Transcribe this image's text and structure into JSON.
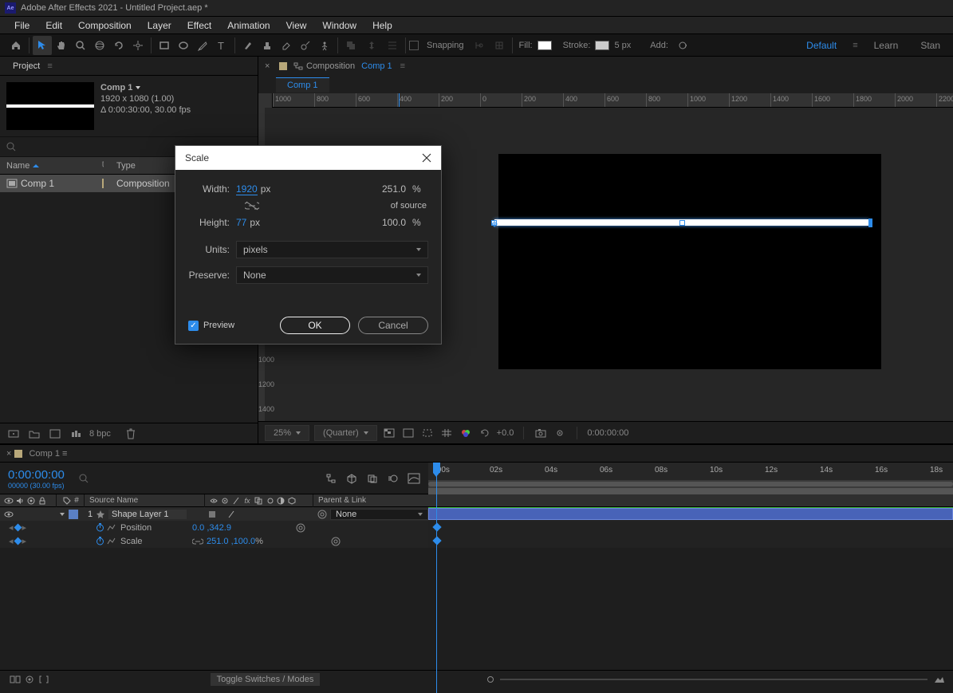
{
  "titlebar": {
    "app": "Adobe After Effects 2021",
    "file": "Untitled Project.aep *",
    "logo": "Ae"
  },
  "menu": [
    "File",
    "Edit",
    "Composition",
    "Layer",
    "Effect",
    "Animation",
    "View",
    "Window",
    "Help"
  ],
  "toolbar": {
    "snapping": "Snapping",
    "fill_label": "Fill:",
    "stroke_label": "Stroke:",
    "stroke_px": "5 px",
    "add_label": "Add:",
    "ws_default": "Default",
    "ws_learn": "Learn",
    "ws_standard": "Stan"
  },
  "project": {
    "tab": "Project",
    "comp_name": "Comp 1",
    "dims": "1920 x 1080 (1.00)",
    "dur": "Δ 0:00:30:00, 30.00 fps",
    "col_name": "Name",
    "col_type": "Type",
    "row_name": "Comp 1",
    "row_type": "Composition",
    "bpc": "8 bpc"
  },
  "comp_panel": {
    "label": "Composition",
    "name": "Comp 1",
    "subtab": "Comp 1",
    "ruler_ticks": [
      "1000",
      "800",
      "600",
      "400",
      "200",
      "0",
      "200",
      "400",
      "600",
      "800",
      "1000",
      "1200",
      "1400",
      "1600",
      "1800",
      "2000",
      "2200"
    ]
  },
  "comp_footer": {
    "zoom": "25%",
    "res": "(Quarter)",
    "exposure": "+0.0",
    "time": "0:00:00:00"
  },
  "dialog": {
    "title": "Scale",
    "width_label": "Width:",
    "width_val": "1920",
    "width_unit": "px",
    "width_pct": "251.0",
    "height_label": "Height:",
    "height_val": "77",
    "height_unit": "px",
    "height_pct": "100.0",
    "pct": "%",
    "of_source": "of source",
    "units_label": "Units:",
    "units_val": "pixels",
    "preserve_label": "Preserve:",
    "preserve_val": "None",
    "preview": "Preview",
    "ok": "OK",
    "cancel": "Cancel"
  },
  "timeline": {
    "tab": "Comp 1",
    "timecode": "0:00:00:00",
    "frames": "00000 (30.00 fps)",
    "ticks": [
      ":00s",
      "02s",
      "04s",
      "06s",
      "08s",
      "10s",
      "12s",
      "14s",
      "16s",
      "18s"
    ],
    "cols": {
      "num": "#",
      "source": "Source Name",
      "parent": "Parent & Link"
    },
    "layer": {
      "num": "1",
      "name": "Shape Layer 1",
      "parent_none": "None",
      "pos_label": "Position",
      "pos_val": "0.0 ,342.9",
      "scale_label": "Scale",
      "scale_val": "251.0 ,100.0",
      "scale_pct": " %"
    },
    "toggle": "Toggle Switches / Modes"
  }
}
